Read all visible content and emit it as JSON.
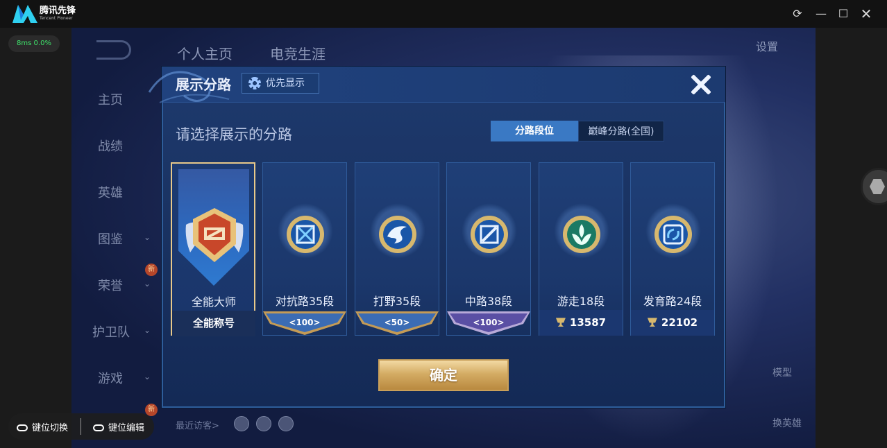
{
  "titlebar": {
    "app_cn": "腾讯先锋",
    "app_en": "Tencent Pioneer"
  },
  "perf": {
    "text": "8ms  0.0%"
  },
  "game": {
    "tabs": [
      "个人主页",
      "电竞生涯"
    ],
    "sidebar": [
      "主页",
      "战绩",
      "英雄",
      "图鉴",
      "荣誉",
      "护卫队",
      "游戏"
    ],
    "new_badge": "新",
    "settings": "设置",
    "visitors": "最近访客>",
    "right_labels": [
      "模型",
      "换英雄"
    ]
  },
  "modal": {
    "title": "展示分路",
    "priority_label": "优先显示",
    "prompt": "请选择展示的分路",
    "segments": [
      {
        "label": "分路段位",
        "active": true
      },
      {
        "label": "巅峰分路(全国)",
        "active": false
      }
    ],
    "cards": [
      {
        "label": "全能大师",
        "bottom": "全能称号",
        "selected": true
      },
      {
        "label": "对抗路35段",
        "bottom": "100",
        "selected": false
      },
      {
        "label": "打野35段",
        "bottom": "50",
        "selected": false
      },
      {
        "label": "中路38段",
        "bottom": "100",
        "selected": false
      },
      {
        "label": "游走18段",
        "bottom": "13587",
        "selected": false
      },
      {
        "label": "发育路24段",
        "bottom": "22102",
        "selected": false
      }
    ],
    "confirm": "确定"
  },
  "keybar": {
    "switch": "键位切换",
    "edit": "键位编辑"
  },
  "colors": {
    "accent": "#3a79c4",
    "gold": "#d4ac64",
    "panel": "#1e3a6e"
  }
}
